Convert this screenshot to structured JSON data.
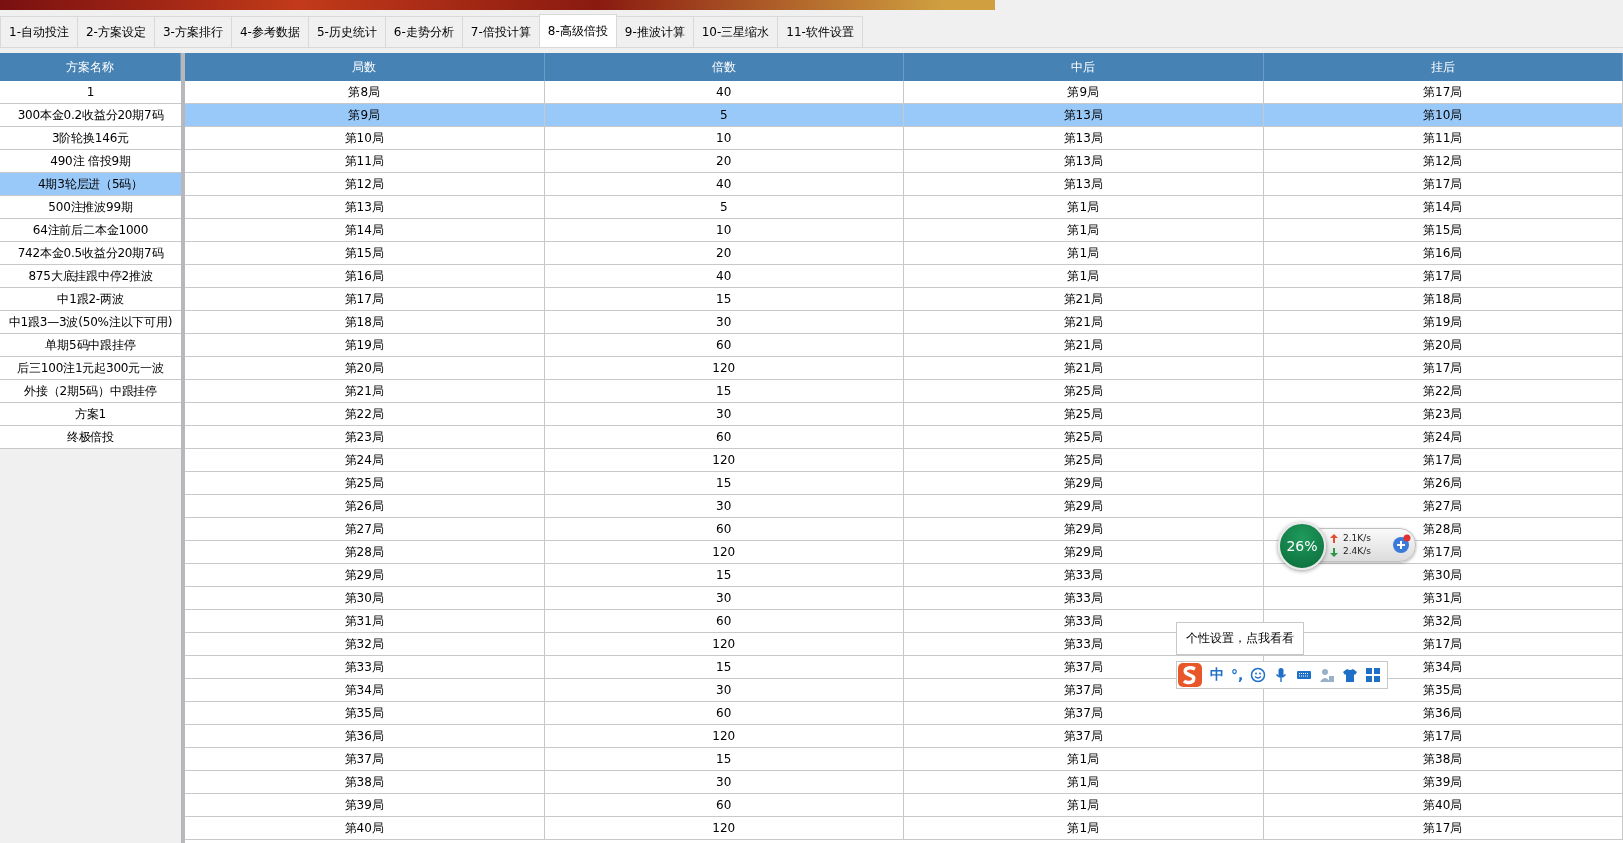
{
  "tabs": [
    {
      "label": "1-自动投注",
      "selected": false
    },
    {
      "label": "2-方案设定",
      "selected": false
    },
    {
      "label": "3-方案排行",
      "selected": false
    },
    {
      "label": "4-参考数据",
      "selected": false
    },
    {
      "label": "5-历史统计",
      "selected": false
    },
    {
      "label": "6-走势分析",
      "selected": false
    },
    {
      "label": "7-倍投计算",
      "selected": false
    },
    {
      "label": "8-高级倍投",
      "selected": true
    },
    {
      "label": "9-推波计算",
      "selected": false
    },
    {
      "label": "10-三星缩水",
      "selected": false
    },
    {
      "label": "11-软件设置",
      "selected": false
    }
  ],
  "scheme_list": {
    "title": "方案名称",
    "items": [
      {
        "label": "1",
        "selected": false
      },
      {
        "label": "300本金0.2收益分20期7码",
        "selected": false
      },
      {
        "label": "3阶轮换146元",
        "selected": false
      },
      {
        "label": "490注 倍投9期",
        "selected": false
      },
      {
        "label": "4期3轮层进（5码）",
        "selected": true
      },
      {
        "label": "500注推波99期",
        "selected": false
      },
      {
        "label": "64注前后二本金1000",
        "selected": false
      },
      {
        "label": "742本金0.5收益分20期7码",
        "selected": false
      },
      {
        "label": "875大底挂跟中停2推波",
        "selected": false
      },
      {
        "label": "中1跟2-两波",
        "selected": false
      },
      {
        "label": "中1跟3—3波(50%注以下可用)",
        "selected": false
      },
      {
        "label": "单期5码中跟挂停",
        "selected": false
      },
      {
        "label": "后三100注1元起300元一波",
        "selected": false
      },
      {
        "label": "外接（2期5码）中跟挂停",
        "selected": false
      },
      {
        "label": "方案1",
        "selected": false
      },
      {
        "label": "终极倍投",
        "selected": false
      }
    ]
  },
  "table": {
    "columns": [
      "局数",
      "倍数",
      "中后",
      "挂后"
    ],
    "rows": [
      {
        "cells": [
          "第8局",
          "40",
          "第9局",
          "第17局"
        ],
        "selected": false
      },
      {
        "cells": [
          "第9局",
          "5",
          "第13局",
          "第10局"
        ],
        "selected": true
      },
      {
        "cells": [
          "第10局",
          "10",
          "第13局",
          "第11局"
        ],
        "selected": false
      },
      {
        "cells": [
          "第11局",
          "20",
          "第13局",
          "第12局"
        ],
        "selected": false
      },
      {
        "cells": [
          "第12局",
          "40",
          "第13局",
          "第17局"
        ],
        "selected": false
      },
      {
        "cells": [
          "第13局",
          "5",
          "第1局",
          "第14局"
        ],
        "selected": false
      },
      {
        "cells": [
          "第14局",
          "10",
          "第1局",
          "第15局"
        ],
        "selected": false
      },
      {
        "cells": [
          "第15局",
          "20",
          "第1局",
          "第16局"
        ],
        "selected": false
      },
      {
        "cells": [
          "第16局",
          "40",
          "第1局",
          "第17局"
        ],
        "selected": false
      },
      {
        "cells": [
          "第17局",
          "15",
          "第21局",
          "第18局"
        ],
        "selected": false
      },
      {
        "cells": [
          "第18局",
          "30",
          "第21局",
          "第19局"
        ],
        "selected": false
      },
      {
        "cells": [
          "第19局",
          "60",
          "第21局",
          "第20局"
        ],
        "selected": false
      },
      {
        "cells": [
          "第20局",
          "120",
          "第21局",
          "第17局"
        ],
        "selected": false
      },
      {
        "cells": [
          "第21局",
          "15",
          "第25局",
          "第22局"
        ],
        "selected": false
      },
      {
        "cells": [
          "第22局",
          "30",
          "第25局",
          "第23局"
        ],
        "selected": false
      },
      {
        "cells": [
          "第23局",
          "60",
          "第25局",
          "第24局"
        ],
        "selected": false
      },
      {
        "cells": [
          "第24局",
          "120",
          "第25局",
          "第17局"
        ],
        "selected": false
      },
      {
        "cells": [
          "第25局",
          "15",
          "第29局",
          "第26局"
        ],
        "selected": false
      },
      {
        "cells": [
          "第26局",
          "30",
          "第29局",
          "第27局"
        ],
        "selected": false
      },
      {
        "cells": [
          "第27局",
          "60",
          "第29局",
          "第28局"
        ],
        "selected": false
      },
      {
        "cells": [
          "第28局",
          "120",
          "第29局",
          "第17局"
        ],
        "selected": false
      },
      {
        "cells": [
          "第29局",
          "15",
          "第33局",
          "第30局"
        ],
        "selected": false
      },
      {
        "cells": [
          "第30局",
          "30",
          "第33局",
          "第31局"
        ],
        "selected": false
      },
      {
        "cells": [
          "第31局",
          "60",
          "第33局",
          "第32局"
        ],
        "selected": false
      },
      {
        "cells": [
          "第32局",
          "120",
          "第33局",
          "第17局"
        ],
        "selected": false
      },
      {
        "cells": [
          "第33局",
          "15",
          "第37局",
          "第34局"
        ],
        "selected": false
      },
      {
        "cells": [
          "第34局",
          "30",
          "第37局",
          "第35局"
        ],
        "selected": false
      },
      {
        "cells": [
          "第35局",
          "60",
          "第37局",
          "第36局"
        ],
        "selected": false
      },
      {
        "cells": [
          "第36局",
          "120",
          "第37局",
          "第17局"
        ],
        "selected": false
      },
      {
        "cells": [
          "第37局",
          "15",
          "第1局",
          "第38局"
        ],
        "selected": false
      },
      {
        "cells": [
          "第38局",
          "30",
          "第1局",
          "第39局"
        ],
        "selected": false
      },
      {
        "cells": [
          "第39局",
          "60",
          "第1局",
          "第40局"
        ],
        "selected": false
      },
      {
        "cells": [
          "第40局",
          "120",
          "第1局",
          "第17局"
        ],
        "selected": false
      }
    ]
  },
  "net_monitor": {
    "percent": "26%",
    "upload": "2.1K/s",
    "download": "2.4K/s"
  },
  "ime_toolbar": {
    "tooltip": "个性设置，点我看看",
    "mode": "中",
    "punctuation": "°,"
  }
}
